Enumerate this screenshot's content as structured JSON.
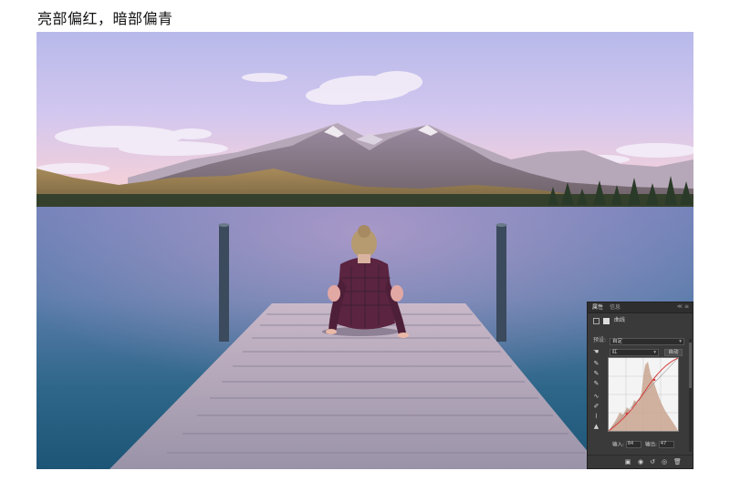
{
  "heading": "亮部偏红，暗部偏青",
  "photo": {
    "description_icon": "lake-pier-photo"
  },
  "panel": {
    "tab_properties": "属性",
    "tab_info": "信息",
    "window_controls": "≪ ≡",
    "adjustment_name": "曲线",
    "preset_label": "预设:",
    "preset_value": "自定",
    "channel_value": "红",
    "auto_button": "自动",
    "input_label": "输入:",
    "input_value": "84",
    "output_label": "输出:",
    "output_value": "47"
  },
  "colors": {
    "panel_bg": "#3a3a3a",
    "histogram": "#c9a48f",
    "curve": "#d43a3a"
  }
}
